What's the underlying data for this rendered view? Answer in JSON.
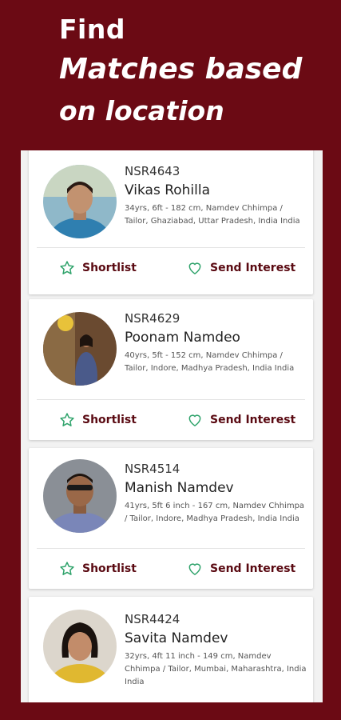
{
  "promo": {
    "line1": "Find",
    "line2": "Matches based",
    "line3": "on location"
  },
  "colors": {
    "background": "#6b0a14",
    "accent_green": "#2fa36b",
    "action_text": "#5a0a12"
  },
  "actions": {
    "shortlist_label": "Shortlist",
    "shortlist_icon": "star-icon",
    "interest_label": "Send Interest",
    "interest_icon": "heart-icon"
  },
  "profiles": [
    {
      "id": "NSR4643",
      "name": "Vikas Rohilla",
      "details": "34yrs, 6ft - 182 cm, Namdev Chhimpa / Tailor, Ghaziabad, Uttar Pradesh, India India"
    },
    {
      "id": "NSR4629",
      "name": "Poonam Namdeo",
      "details": "40yrs, 5ft - 152 cm, Namdev Chhimpa / Tailor, Indore, Madhya Pradesh, India India"
    },
    {
      "id": "NSR4514",
      "name": "Manish Namdev",
      "details": "41yrs, 5ft 6 inch - 167 cm, Namdev Chhimpa / Tailor, Indore, Madhya Pradesh, India India"
    },
    {
      "id": "NSR4424",
      "name": "Savita Namdev",
      "details": "32yrs, 4ft 11 inch - 149 cm, Namdev Chhimpa / Tailor, Mumbai, Maharashtra, India India"
    }
  ]
}
